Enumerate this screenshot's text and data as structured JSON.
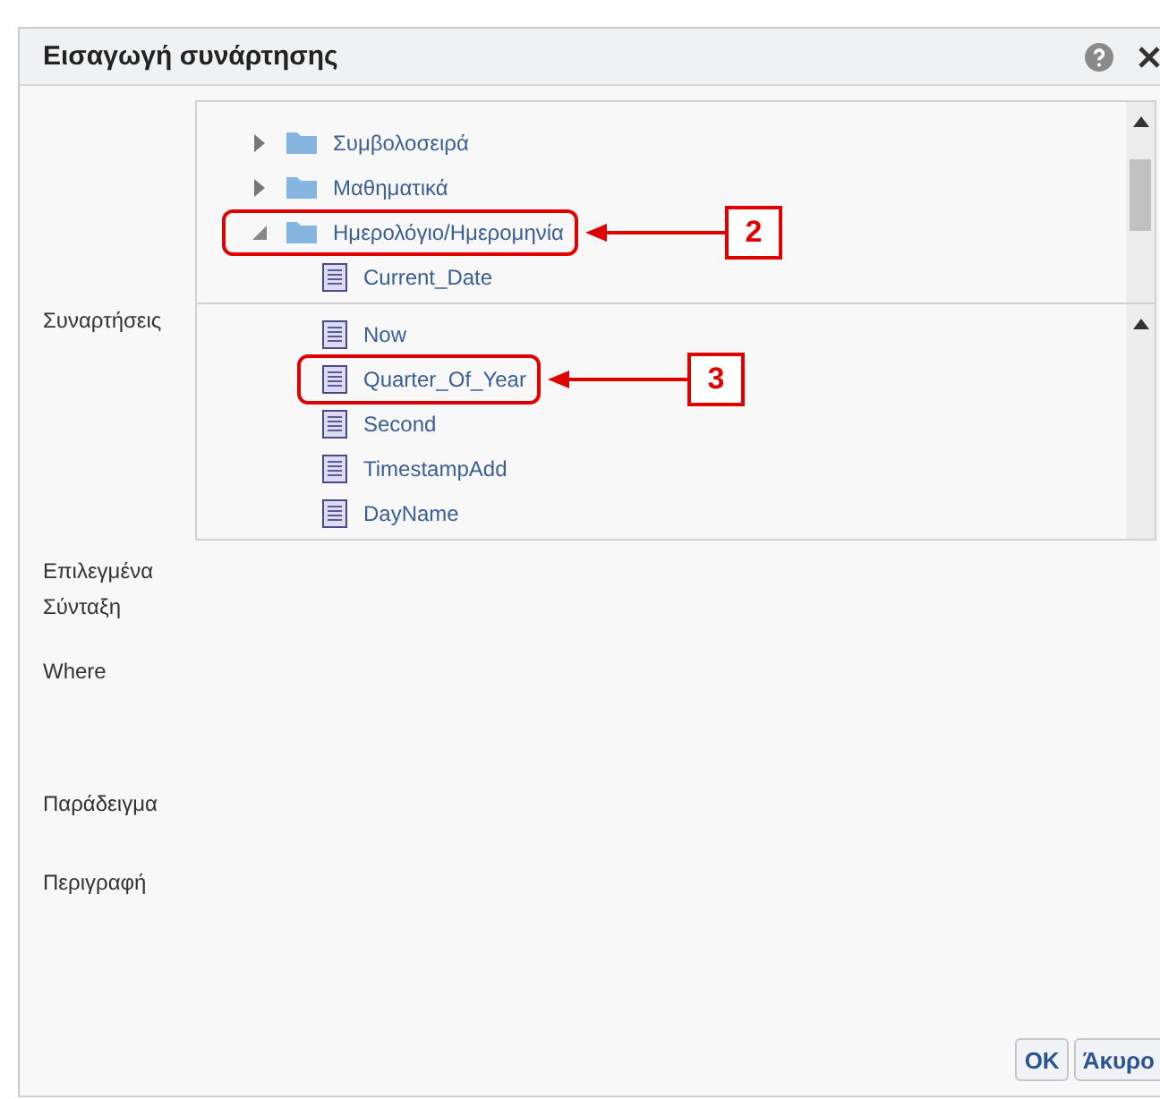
{
  "dialog": {
    "title": "Εισαγωγή συνάρτησης"
  },
  "functions_label": "Συναρτήσεις",
  "category_tree": [
    {
      "label": "Συμβολοσειρά",
      "expanded": false
    },
    {
      "label": "Μαθηματικά",
      "expanded": false
    },
    {
      "label": "Ημερολόγιο/Ημερομηνία",
      "expanded": true,
      "callout": "2",
      "children": [
        {
          "label": "Current_Date"
        }
      ]
    }
  ],
  "function_list": [
    {
      "label": "Now"
    },
    {
      "label": "Quarter_Of_Year",
      "callout": "3"
    },
    {
      "label": "Second"
    },
    {
      "label": "TimestampAdd"
    },
    {
      "label": "DayName"
    }
  ],
  "fields": [
    "Επιλεγμένα",
    "Σύνταξη",
    "Where",
    "Παράδειγμα",
    "Περιγραφή"
  ],
  "buttons": [
    "OK",
    "Άκυρο"
  ]
}
